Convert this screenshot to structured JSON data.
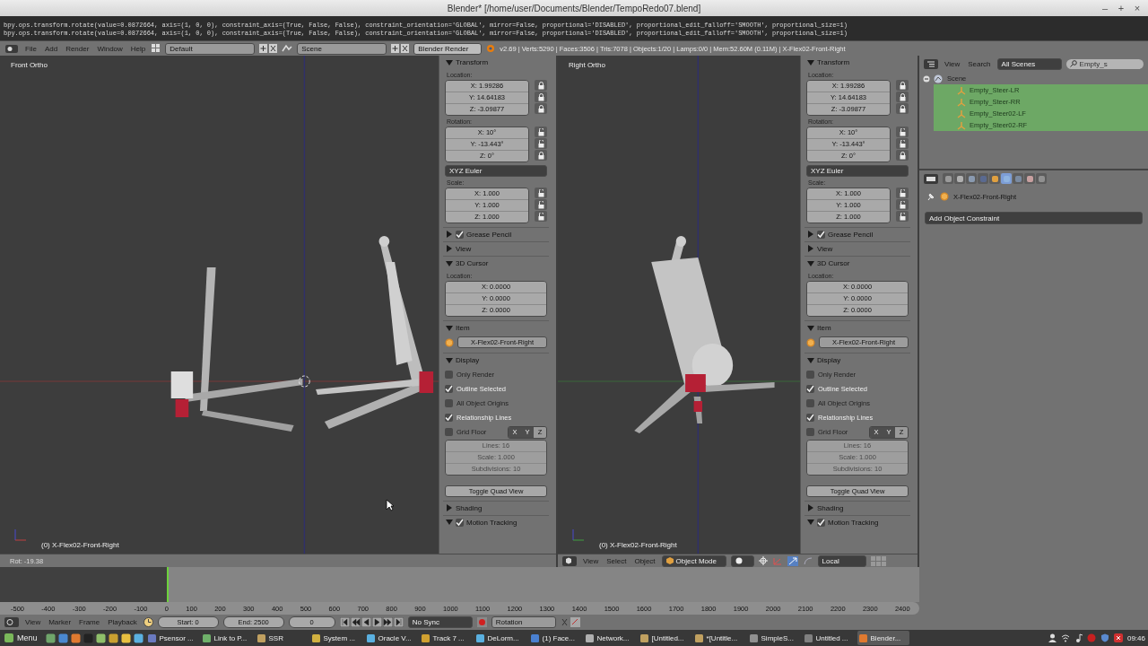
{
  "window": {
    "title": "Blender* [/home/user/Documents/Blender/TempoRedo07.blend]",
    "controls": [
      "–",
      "+",
      "×"
    ]
  },
  "console": {
    "lines": [
      "bpy.ops.transform.rotate(value=0.0872664, axis=(1, 0, 0), constraint_axis=(True, False, False), constraint_orientation='GLOBAL', mirror=False, proportional='DISABLED', proportional_edit_falloff='SMOOTH', proportional_size=1)",
      "bpy.ops.transform.rotate(value=0.0872664, axis=(1, 0, 0), constraint_axis=(True, False, False), constraint_orientation='GLOBAL', mirror=False, proportional='DISABLED', proportional_edit_falloff='SMOOTH', proportional_size=1)"
    ]
  },
  "info_header": {
    "menus": [
      "File",
      "Add",
      "Render",
      "Window",
      "Help"
    ],
    "layout": "Default",
    "scene": "Scene",
    "engine": "Blender Render",
    "stats": "v2.69 | Verts:5290 | Faces:3506 | Tris:7078 | Objects:1/20 | Lamps:0/0 | Mem:52.60M (0.11M) | X-Flex02-Front-Right"
  },
  "viewports": [
    {
      "kind": "front",
      "view": "Front Ortho",
      "object": "(0) X-Flex02-Front-Right",
      "header": {
        "kind": "status",
        "text": "Rot: -19.38"
      },
      "panel": {
        "sections": [
          {
            "kind": "transform",
            "title": "Transform",
            "expanded": true,
            "groups": [
              {
                "label": "Location:",
                "fields": [
                  {
                    "value": "X: 1.99286",
                    "locked": true
                  },
                  {
                    "value": "Y: 14.64183",
                    "locked": true
                  },
                  {
                    "value": "Z: -3.09877",
                    "locked": true
                  }
                ]
              },
              {
                "label": "Rotation:",
                "fields": [
                  {
                    "value": "X: 10°",
                    "locked": false
                  },
                  {
                    "value": "Y: -13.443°",
                    "locked": false
                  },
                  {
                    "value": "Z: 0°",
                    "locked": true
                  }
                ],
                "dropdown": "XYZ Euler"
              },
              {
                "label": "Scale:",
                "fields": [
                  {
                    "value": "X: 1.000",
                    "locked": false
                  },
                  {
                    "value": "Y: 1.000",
                    "locked": false
                  },
                  {
                    "value": "Z: 1.000",
                    "locked": false
                  }
                ]
              }
            ]
          },
          {
            "kind": "header",
            "title": "Grease Pencil",
            "expanded": false,
            "checked": true
          },
          {
            "kind": "header",
            "title": "View",
            "expanded": false
          },
          {
            "kind": "cursor",
            "title": "3D Cursor",
            "expanded": true,
            "label": "Location:",
            "fields": [
              "X: 0.0000",
              "Y: 0.0000",
              "Z: 0.0000"
            ]
          },
          {
            "kind": "item",
            "title": "Item",
            "expanded": true,
            "name": "X-Flex02-Front-Right"
          },
          {
            "kind": "display",
            "title": "Display",
            "expanded": true,
            "options": [
              {
                "label": "Only Render",
                "checked": false
              },
              {
                "label": "Outline Selected",
                "checked": true
              },
              {
                "label": "All Object Origins",
                "checked": false
              },
              {
                "label": "Relationship Lines",
                "checked": true
              }
            ],
            "grid_floor": {
              "label": "Grid Floor",
              "checked": false,
              "axes": [
                {
                  "label": "X",
                  "selected": true
                },
                {
                  "label": "Y",
                  "selected": true
                },
                {
                  "label": "Z",
                  "selected": false
                }
              ]
            },
            "grid_fields": {
              "disabled": true,
              "values": [
                "Lines: 16",
                "Scale: 1.000",
                "Subdivisions: 10"
              ]
            },
            "button": "Toggle Quad View"
          },
          {
            "kind": "header",
            "title": "Shading",
            "expanded": false
          },
          {
            "kind": "header",
            "title": "Motion Tracking",
            "expanded": true,
            "checked": true
          }
        ]
      }
    },
    {
      "kind": "right",
      "view": "Right Ortho",
      "object": "(0) X-Flex02-Front-Right",
      "header": {
        "kind": "menus",
        "menus": [
          "View",
          "Select",
          "Object"
        ],
        "mode": "Object Mode",
        "orientation": "Local"
      },
      "panel": {
        "sections": [
          {
            "kind": "transform",
            "title": "Transform",
            "expanded": true,
            "groups": [
              {
                "label": "Location:",
                "fields": [
                  {
                    "value": "X: 1.99286",
                    "locked": true
                  },
                  {
                    "value": "Y: 14.64183",
                    "locked": true
                  },
                  {
                    "value": "Z: -3.09877",
                    "locked": true
                  }
                ]
              },
              {
                "label": "Rotation:",
                "fields": [
                  {
                    "value": "X: 10°",
                    "locked": false
                  },
                  {
                    "value": "Y: -13.443°",
                    "locked": false
                  },
                  {
                    "value": "Z: 0°",
                    "locked": true
                  }
                ],
                "dropdown": "XYZ Euler"
              },
              {
                "label": "Scale:",
                "fields": [
                  {
                    "value": "X: 1.000",
                    "locked": false
                  },
                  {
                    "value": "Y: 1.000",
                    "locked": false
                  },
                  {
                    "value": "Z: 1.000",
                    "locked": false
                  }
                ]
              }
            ]
          },
          {
            "kind": "header",
            "title": "Grease Pencil",
            "expanded": false,
            "checked": true
          },
          {
            "kind": "header",
            "title": "View",
            "expanded": false
          },
          {
            "kind": "cursor",
            "title": "3D Cursor",
            "expanded": true,
            "label": "Location:",
            "fields": [
              "X: 0.0000",
              "Y: 0.0000",
              "Z: 0.0000"
            ]
          },
          {
            "kind": "item",
            "title": "Item",
            "expanded": true,
            "name": "X-Flex02-Front-Right"
          },
          {
            "kind": "display",
            "title": "Display",
            "expanded": true,
            "options": [
              {
                "label": "Only Render",
                "checked": false
              },
              {
                "label": "Outline Selected",
                "checked": true
              },
              {
                "label": "All Object Origins",
                "checked": false
              },
              {
                "label": "Relationship Lines",
                "checked": true
              }
            ],
            "grid_floor": {
              "label": "Grid Floor",
              "checked": false,
              "axes": [
                {
                  "label": "X",
                  "selected": true
                },
                {
                  "label": "Y",
                  "selected": true
                },
                {
                  "label": "Z",
                  "selected": false
                }
              ]
            },
            "grid_fields": {
              "disabled": true,
              "values": [
                "Lines: 16",
                "Scale: 1.000",
                "Subdivisions: 10"
              ]
            },
            "button": "Toggle Quad View"
          },
          {
            "kind": "header",
            "title": "Shading",
            "expanded": false
          },
          {
            "kind": "header",
            "title": "Motion Tracking",
            "expanded": true,
            "checked": true
          }
        ]
      }
    }
  ],
  "outliner": {
    "menus": [
      "View",
      "Search"
    ],
    "scope": "All Scenes",
    "search": "Empty_s",
    "tree": [
      {
        "label": "Scene",
        "expanded": true,
        "selected": false,
        "children": [
          {
            "label": "Empty_Steer-LR",
            "selected": true
          },
          {
            "label": "Empty_Steer-RR",
            "selected": true
          },
          {
            "label": "Empty_Steer02-LF",
            "selected": true
          },
          {
            "label": "Empty_Steer02-RF",
            "selected": true
          }
        ]
      }
    ]
  },
  "properties": {
    "tabs": [
      {
        "selected": false
      },
      {
        "selected": false
      },
      {
        "selected": false
      },
      {
        "selected": false
      },
      {
        "selected": false
      },
      {
        "selected": true
      },
      {
        "selected": false
      },
      {
        "selected": false
      },
      {
        "selected": false
      }
    ],
    "object": "X-Flex02-Front-Right",
    "add_constraint": "Add Object Constraint"
  },
  "timeline": {
    "ruler": [
      "-500",
      "-400",
      "-300",
      "-200",
      "-100",
      "0",
      "100",
      "200",
      "300",
      "400",
      "500",
      "600",
      "700",
      "800",
      "900",
      "1000",
      "1100",
      "1200",
      "1300",
      "1400",
      "1500",
      "1600",
      "1700",
      "1800",
      "1900",
      "2000",
      "2100",
      "2200",
      "2300",
      "2400"
    ],
    "menus": [
      "View",
      "Marker",
      "Frame",
      "Playback"
    ],
    "start": "Start: 0",
    "end": "End: 2500",
    "frame": "0",
    "sync": "No Sync",
    "keying_set": "Rotation"
  },
  "taskbar": {
    "menu": "Menu",
    "tasks": [
      {
        "label": "Psensor ...",
        "selected": false
      },
      {
        "label": "Link to P...",
        "selected": false
      },
      {
        "label": "SSR",
        "selected": false
      },
      {
        "label": "System ...",
        "selected": false
      },
      {
        "label": "Oracle V...",
        "selected": false
      },
      {
        "label": "Track 7 ...",
        "selected": false
      },
      {
        "label": "DeLorm...",
        "selected": false
      },
      {
        "label": "(1) Face...",
        "selected": false
      },
      {
        "label": "Network...",
        "selected": false
      },
      {
        "label": "[Untitled...",
        "selected": false
      },
      {
        "label": "*[Untitle...",
        "selected": false
      },
      {
        "label": "SimpleS...",
        "selected": false
      },
      {
        "label": "Untitled ...",
        "selected": false
      },
      {
        "label": "Blender...",
        "selected": true
      }
    ],
    "clock": "09:46"
  }
}
